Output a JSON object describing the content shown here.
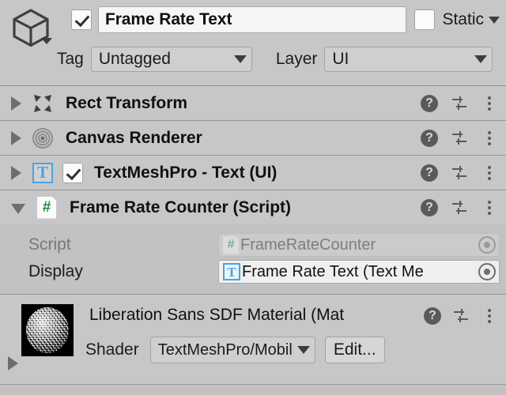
{
  "header": {
    "gameobject_icon": "cube-icon",
    "enabled_checkbox": true,
    "name": "Frame Rate Text",
    "static_label": "Static",
    "static_checked": false,
    "tag_label": "Tag",
    "tag_value": "Untagged",
    "layer_label": "Layer",
    "layer_value": "UI"
  },
  "components": [
    {
      "title": "Rect Transform",
      "icon": "rect-transform-icon",
      "expanded": false,
      "has_enable_checkbox": false,
      "enabled": false
    },
    {
      "title": "Canvas Renderer",
      "icon": "canvas-renderer-icon",
      "expanded": false,
      "has_enable_checkbox": false,
      "enabled": false
    },
    {
      "title": "TextMeshPro - Text (UI)",
      "icon": "textmeshpro-icon",
      "icon_glyph": "T",
      "expanded": false,
      "has_enable_checkbox": true,
      "enabled": true
    },
    {
      "title": "Frame Rate Counter (Script)",
      "icon": "csharp-script-icon",
      "icon_glyph": "#",
      "expanded": true,
      "has_enable_checkbox": false,
      "enabled": false
    }
  ],
  "component_actions": {
    "help": "?",
    "preset_icon": "preset-sliders-icon",
    "menu_icon": "kebab-menu-icon"
  },
  "script_body": {
    "properties": [
      {
        "label": "Script",
        "value": "FrameRateCounter",
        "icon": "csharp-script-icon",
        "icon_glyph": "#",
        "disabled": true
      },
      {
        "label": "Display",
        "value": "Frame Rate Text (Text Me",
        "icon": "textmeshpro-icon",
        "icon_glyph": "T",
        "disabled": false
      }
    ]
  },
  "material": {
    "title": "Liberation Sans SDF Material (Mat",
    "preview_icon": "material-sphere-preview",
    "shader_label": "Shader",
    "shader_value": "TextMeshPro/Mobile/Dista",
    "edit_button": "Edit..."
  },
  "colors": {
    "window_bg": "#c2c2c2",
    "row_bg": "#c7c7c7",
    "separator": "#959595",
    "text": "#1b1b1b",
    "dim_text": "#787878",
    "accent_blue": "#4aa3e0",
    "accent_green": "#1f8b3d"
  }
}
